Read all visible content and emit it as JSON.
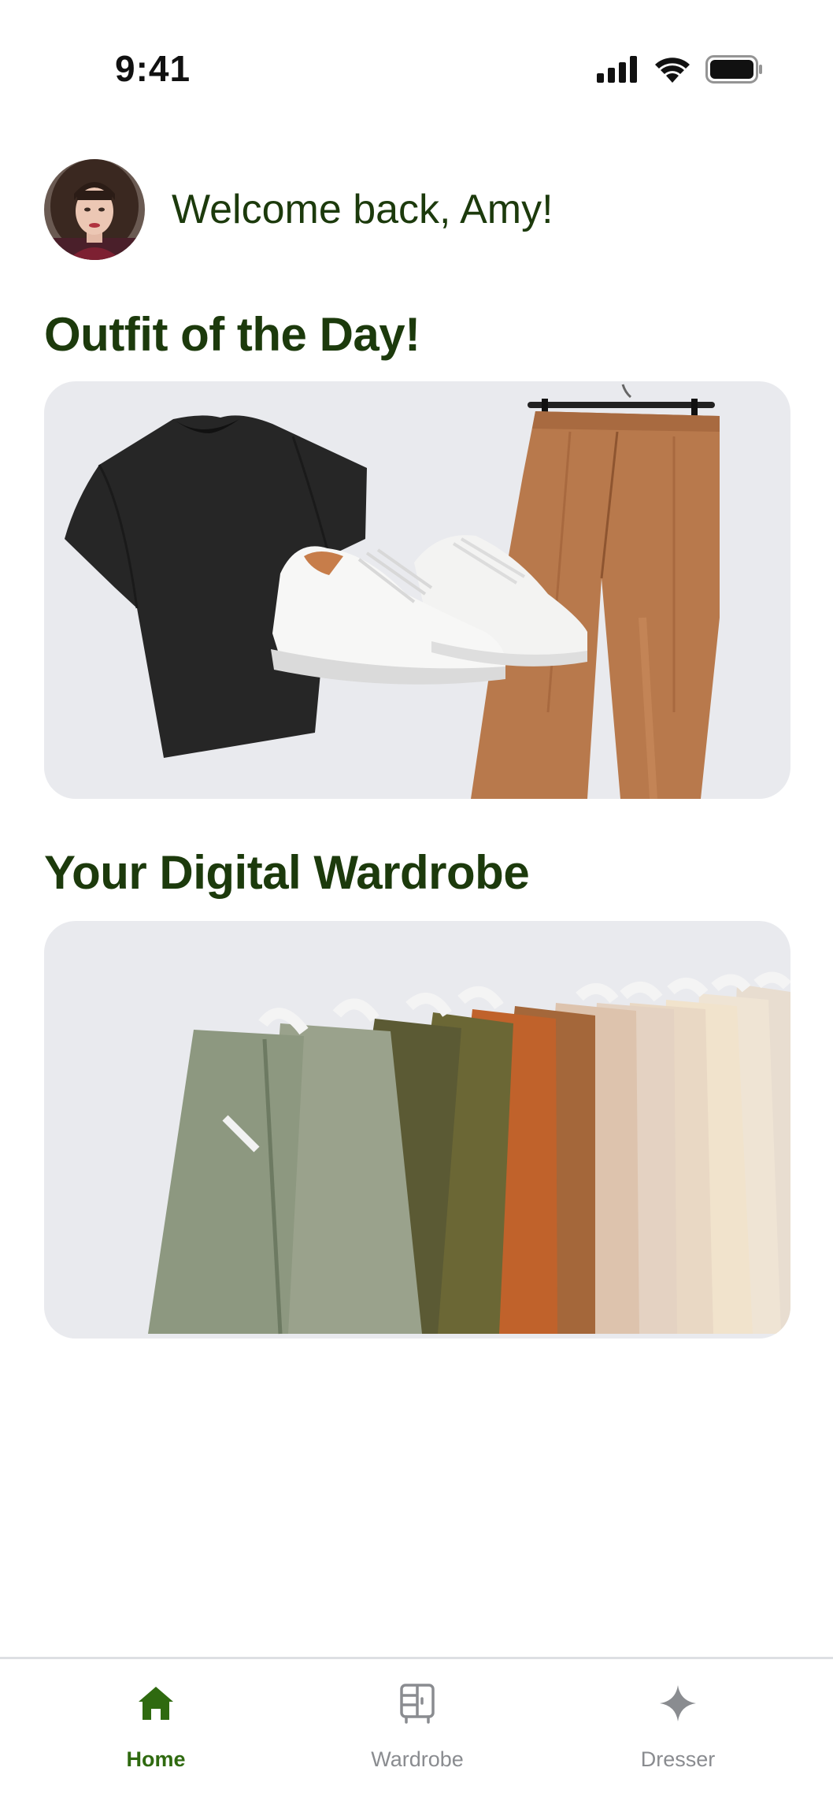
{
  "status_bar": {
    "time": "9:41",
    "icons": [
      "cellular-signal-icon",
      "wifi-icon",
      "battery-icon"
    ]
  },
  "header": {
    "greeting": "Welcome back, Amy!"
  },
  "outfit_section": {
    "title": "Outfit of the Day!",
    "items": [
      "t-shirt",
      "sneakers",
      "trousers"
    ]
  },
  "wardrobe_section": {
    "title": "Your Digital Wardrobe"
  },
  "tab_bar": {
    "tabs": [
      {
        "label": "Home",
        "icon": "home-icon",
        "active": true
      },
      {
        "label": "Wardrobe",
        "icon": "wardrobe-icon",
        "active": false
      },
      {
        "label": "Dresser",
        "icon": "sparkle-icon",
        "active": false
      }
    ]
  },
  "colors": {
    "accent": "#2f6a10",
    "title_text": "#1c3a0c",
    "card_bg": "#e9eaee",
    "inactive_tab": "#8a8c90"
  }
}
